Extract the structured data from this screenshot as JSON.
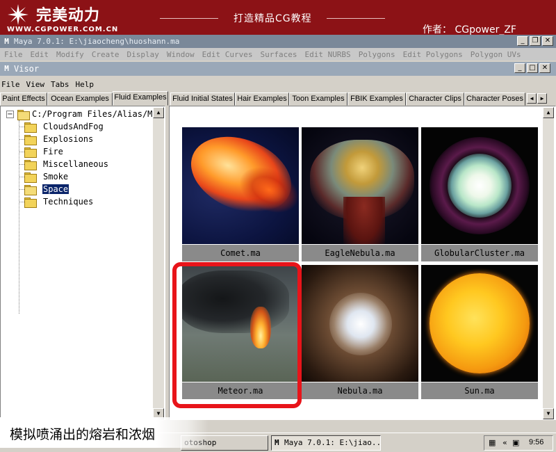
{
  "banner": {
    "logo_text": "完美动力",
    "logo_url": "WWW.CGPOWER.COM.CN",
    "title": "打造精品CG教程",
    "author": "作者： CGpower_ZF"
  },
  "maya_window": {
    "title": "Maya 7.0.1: E:\\jiaocheng\\huoshann.ma",
    "menu": [
      "File",
      "Edit",
      "Modify",
      "Create",
      "Display",
      "Window",
      "Edit Curves",
      "Surfaces",
      "Edit NURBS",
      "Polygons",
      "Edit Polygons",
      "Polygon UVs"
    ]
  },
  "visor": {
    "title": "Visor",
    "menu": [
      "File",
      "View",
      "Tabs",
      "Help"
    ],
    "tabs": [
      "Paint Effects",
      "Ocean Examples",
      "Fluid Examples",
      "Fluid Initial States",
      "Hair Examples",
      "Toon Examples",
      "FBIK Examples",
      "Character Clips",
      "Character Poses"
    ],
    "active_tab": "Fluid Examples",
    "tree": {
      "root": "C:/Program Files/Alias/Ma",
      "items": [
        "CloudsAndFog",
        "Explosions",
        "Fire",
        "Miscellaneous",
        "Smoke",
        "Space",
        "Techniques"
      ],
      "selected": "Space"
    },
    "examples": [
      "Comet.ma",
      "EagleNebula.ma",
      "GlobularCluster.ma",
      "Meteor.ma",
      "Nebula.ma",
      "Sun.ma"
    ],
    "highlighted_example": "Meteor.ma"
  },
  "taskbar": {
    "items": [
      "otoshop",
      "Maya 7.0.1: E:\\jiao..."
    ],
    "time": "9:56"
  },
  "subtitle": "模拟喷涌出的熔岩和浓烟",
  "colors": {
    "banner_bg": "#8c1216",
    "highlight_red": "#e8141a",
    "selection_bg": "#0a246a"
  }
}
